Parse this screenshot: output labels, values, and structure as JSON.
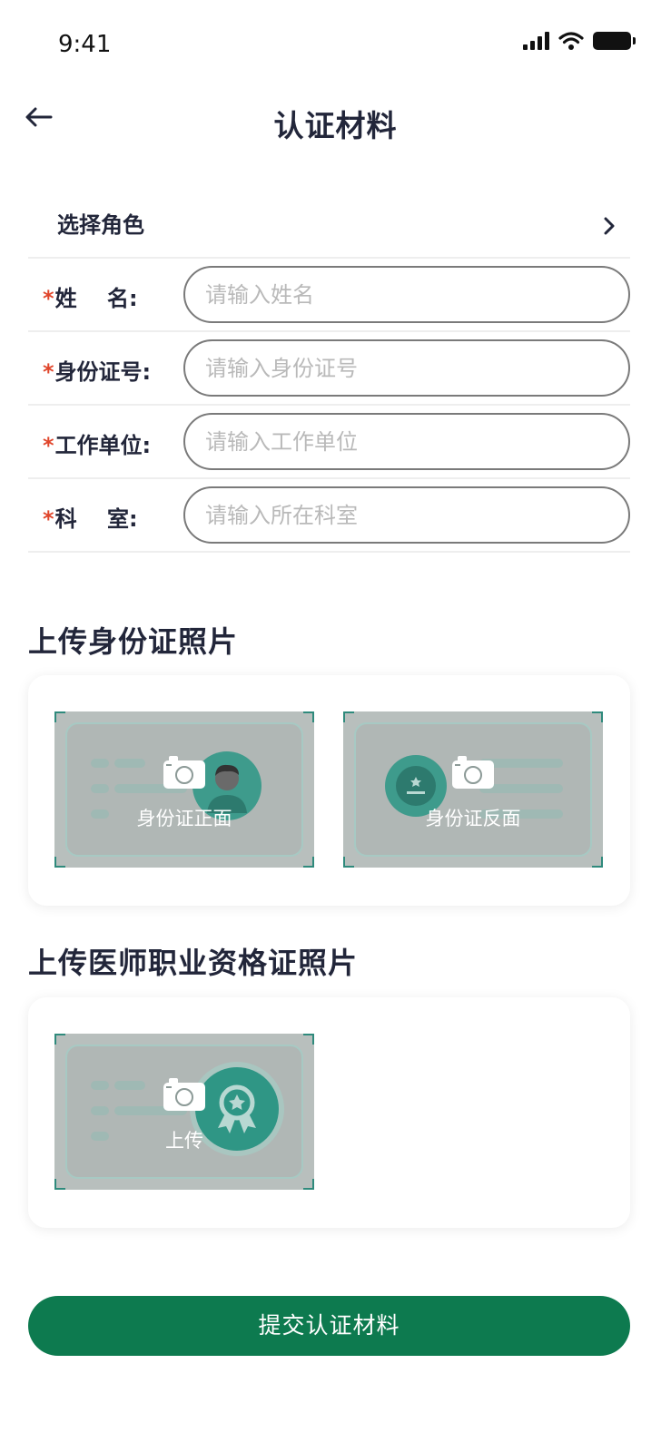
{
  "status_bar": {
    "time": "9:41"
  },
  "nav": {
    "title": "认证材料"
  },
  "form": {
    "role": {
      "label": "选择角色"
    },
    "fields": [
      {
        "required_mark": "*",
        "label": "姓    名:",
        "placeholder": "请输入姓名"
      },
      {
        "required_mark": "*",
        "label": "身份证号:",
        "placeholder": "请输入身份证号"
      },
      {
        "required_mark": "*",
        "label": "工作单位:",
        "placeholder": "请输入工作单位"
      },
      {
        "required_mark": "*",
        "label": "科    室:",
        "placeholder": "请输入所在科室"
      }
    ]
  },
  "id_section": {
    "title": "上传身份证照片",
    "front_label": "身份证正面",
    "back_label": "身份证反面"
  },
  "license_section": {
    "title": "上传医师职业资格证照片",
    "upload_label": "上传"
  },
  "submit": {
    "label": "提交认证材料"
  },
  "colors": {
    "primary": "#0d7a4f",
    "required": "#e0462c",
    "teal_accent": "#2f8a7c"
  }
}
